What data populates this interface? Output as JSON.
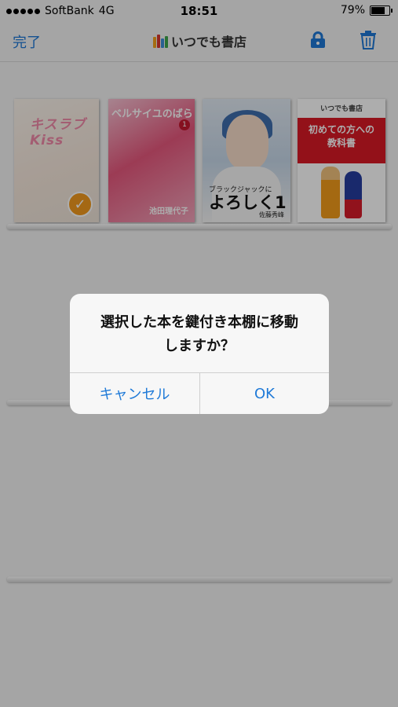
{
  "status_bar": {
    "carrier": "SoftBank",
    "network": "4G",
    "time": "18:51",
    "battery_percent": "79%",
    "battery_level": 0.79
  },
  "nav": {
    "done_label": "完了",
    "title": "いつでも書店",
    "lock_icon": "lock-icon",
    "trash_icon": "trash-icon"
  },
  "books": [
    {
      "cover_title": "キスラブKiss",
      "selected": true
    },
    {
      "cover_title": "ベルサイユのばら",
      "author": "池田理代子",
      "volume": "1"
    },
    {
      "cover_title_small": "ブラックジャックに",
      "cover_title": "よろしく1",
      "author": "佐藤秀峰"
    },
    {
      "publisher_label": "いつでも書店",
      "cover_title_line1": "初めての方への",
      "cover_title_line2": "教科書"
    }
  ],
  "dialog": {
    "message": "選択した本を鍵付き本棚に移動\nしますか？",
    "cancel_label": "キャンセル",
    "ok_label": "OK"
  },
  "colors": {
    "accent": "#1e78d6",
    "overlay": "#7a7a7a",
    "check_badge": "#f29a1e"
  }
}
